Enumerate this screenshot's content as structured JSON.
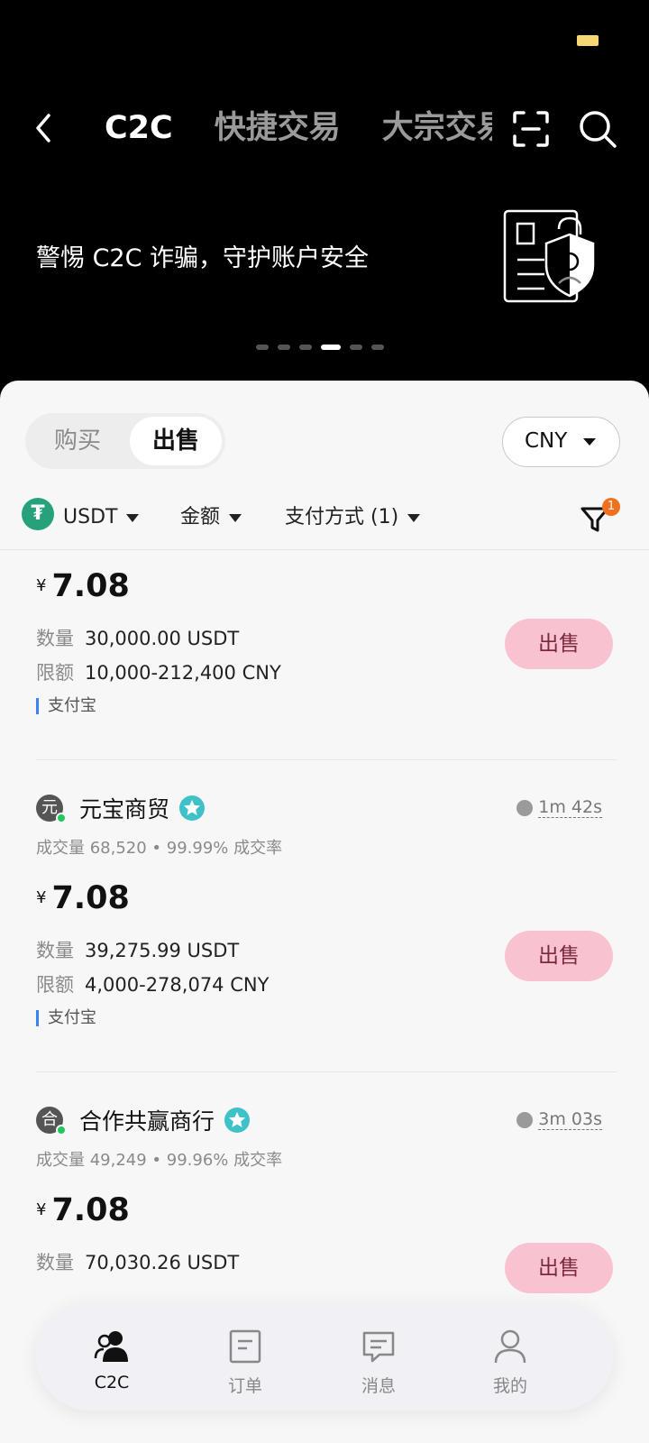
{
  "top_nav": {
    "tabs": [
      {
        "label": "C2C",
        "active": true
      },
      {
        "label": "快捷交易",
        "active": false
      },
      {
        "label": "大宗交易",
        "active": false
      }
    ]
  },
  "banner": {
    "text": "警惕 C2C 诈骗，守护账户安全",
    "slides": 6,
    "active_slide": 4
  },
  "trade": {
    "buy_label": "购买",
    "sell_label": "出售",
    "currency": "CNY"
  },
  "filters": {
    "coin": "USDT",
    "amount": "金额",
    "payment": "支付方式 (1)",
    "badge": "1"
  },
  "listings": [
    {
      "price": "7.08",
      "qty_label": "数量",
      "qty": "30,000.00 USDT",
      "limit_label": "限额",
      "limit": "10,000-212,400 CNY",
      "payment": "支付宝",
      "button": "出售"
    },
    {
      "avatar": "元",
      "name": "元宝商贸",
      "time": "1m 42s",
      "stats": "成交量 68,520  •  99.99% 成交率",
      "price": "7.08",
      "qty_label": "数量",
      "qty": "39,275.99 USDT",
      "limit_label": "限额",
      "limit": "4,000-278,074 CNY",
      "payment": "支付宝",
      "button": "出售"
    },
    {
      "avatar": "合",
      "name": "合作共赢商行",
      "time": "3m 03s",
      "stats": "成交量 49,249  •  99.96% 成交率",
      "price": "7.08",
      "qty_label": "数量",
      "qty": "70,030.26 USDT",
      "button": "出售"
    }
  ],
  "bottom_nav": [
    {
      "label": "C2C",
      "icon": "users-icon",
      "active": true
    },
    {
      "label": "订单",
      "icon": "order-icon",
      "active": false
    },
    {
      "label": "消息",
      "icon": "message-icon",
      "active": false
    },
    {
      "label": "我的",
      "icon": "profile-icon",
      "active": false
    }
  ],
  "colors": {
    "sell_button_bg": "#f9c2d0",
    "online": "#22c55e",
    "usdt": "#26a17b",
    "badge": "#f07020"
  }
}
